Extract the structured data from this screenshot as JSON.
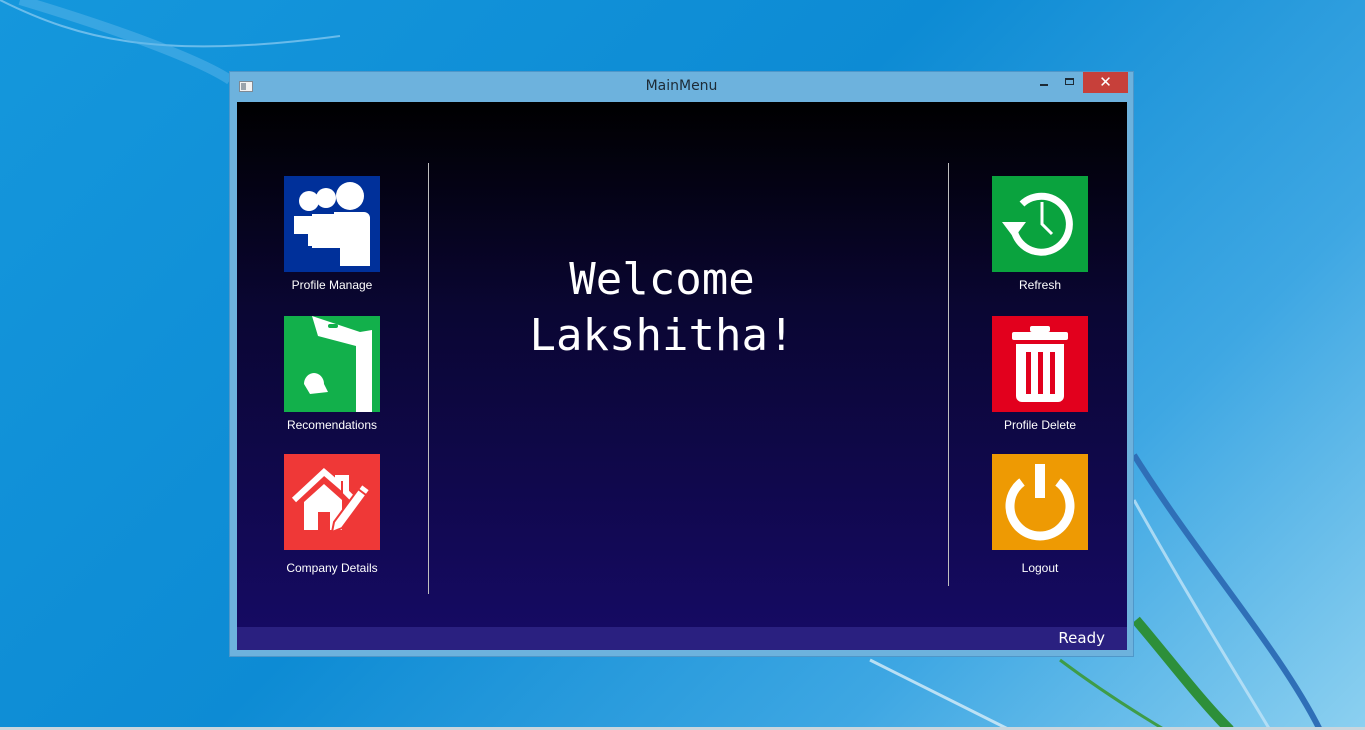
{
  "window": {
    "title": "MainMenu",
    "close_glyph": "✕"
  },
  "welcome": {
    "line1": "Welcome",
    "line2": "Lakshitha!"
  },
  "tiles": {
    "profile_manage": {
      "label": "Profile Manage",
      "color": "#00309a",
      "icon": "users-icon"
    },
    "recommendations": {
      "label": "Recomendations",
      "color": "#12b04b",
      "icon": "box-icon"
    },
    "company_details": {
      "label": "Company Details",
      "color": "#ef3837",
      "icon": "house-edit-icon"
    },
    "refresh": {
      "label": "Refresh",
      "color": "#0aa33e",
      "icon": "history-clock-icon"
    },
    "profile_delete": {
      "label": "Profile Delete",
      "color": "#e2001d",
      "icon": "trash-icon"
    },
    "logout": {
      "label": "Logout",
      "color": "#ee9a03",
      "icon": "power-icon"
    }
  },
  "status": {
    "text": "Ready"
  }
}
